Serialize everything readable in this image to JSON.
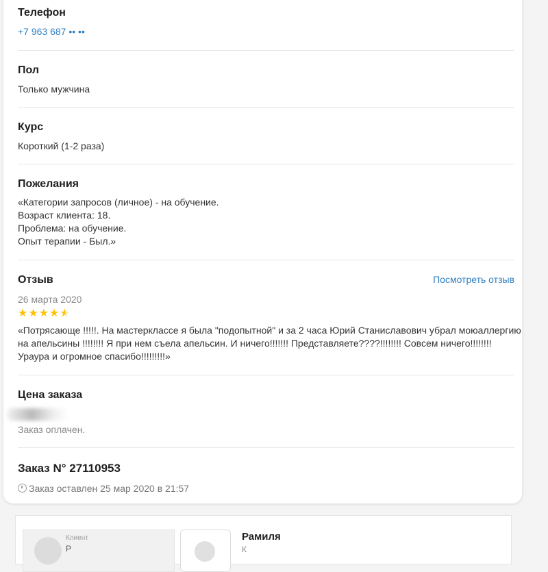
{
  "phone": {
    "label": "Телефон",
    "value": "+7 963 687 •• ••"
  },
  "gender": {
    "label": "Пол",
    "value": "Только мужчина"
  },
  "course": {
    "label": "Курс",
    "value": "Короткий (1-2 раза)"
  },
  "wishes": {
    "label": "Пожелания",
    "lines": [
      "«Категории запросов (личное) - на обучение.",
      "Возраст клиента: 18.",
      "Проблема: на обучение.",
      "Опыт терапии - Был.»"
    ]
  },
  "review": {
    "label": "Отзыв",
    "link": "Посмотреть отзыв",
    "date": "26 марта 2020",
    "rating": 4.5,
    "rating_max": 5,
    "star_color": "#ffc107",
    "text": "«Потрясающе !!!!!. На мастерклассе я была \"подопытной\" и за 2 часа Юрий Станиславович убрал моюаллергию на апельсины !!!!!!!! Я при нем съела апельсин. И ничего!!!!!!! Представляете????!!!!!!!! Совсем ничего!!!!!!!! Ураура и огромное спасибо!!!!!!!!!»"
  },
  "price": {
    "label": "Цена заказа",
    "status": "Заказ оплачен."
  },
  "order": {
    "title": "Заказ N° 27110953",
    "placed": "Заказ оставлен 25 мар 2020 в 21:57"
  },
  "client": {
    "role_label": "Клиент",
    "name_partial": "Р",
    "person_name": "Рамиля",
    "person_sub": "К"
  },
  "accent_color": "#2f7fc1"
}
